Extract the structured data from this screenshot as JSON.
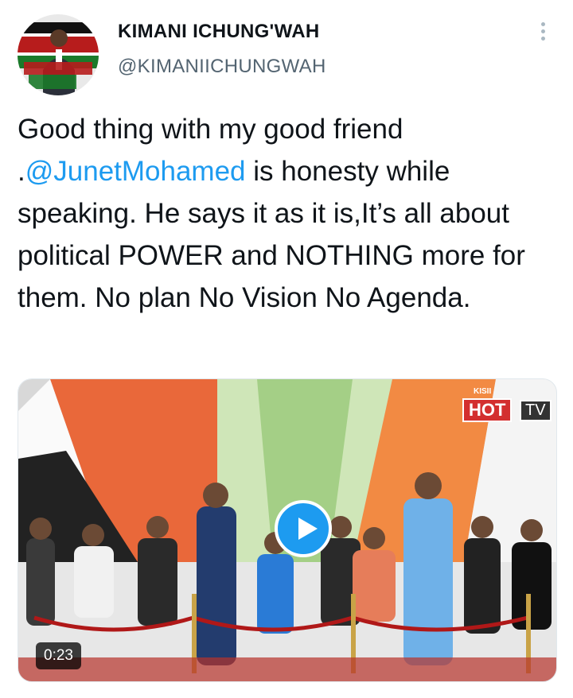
{
  "header": {
    "display_name": "KIMANI ICHUNG'WAH",
    "handle": "@KIMANIICHUNGWAH",
    "avatar_text": "I HAVE YOUR BACK"
  },
  "tweet": {
    "text_before": "Good thing with my good friend .",
    "mention": "@JunetMohamed",
    "text_after": " is honesty while speaking. He says it as it is,It’s all about political POWER and NOTHING more for them. No plan No Vision No Agenda."
  },
  "media": {
    "duration": "0:23",
    "watermark_kisii": "KISII",
    "watermark_hot": "HOT",
    "watermark_tv": "TV",
    "play_icon": "play-icon"
  },
  "colors": {
    "mention": "#1d9bf0",
    "handle": "#536471",
    "play_button": "#1d9bf0"
  }
}
